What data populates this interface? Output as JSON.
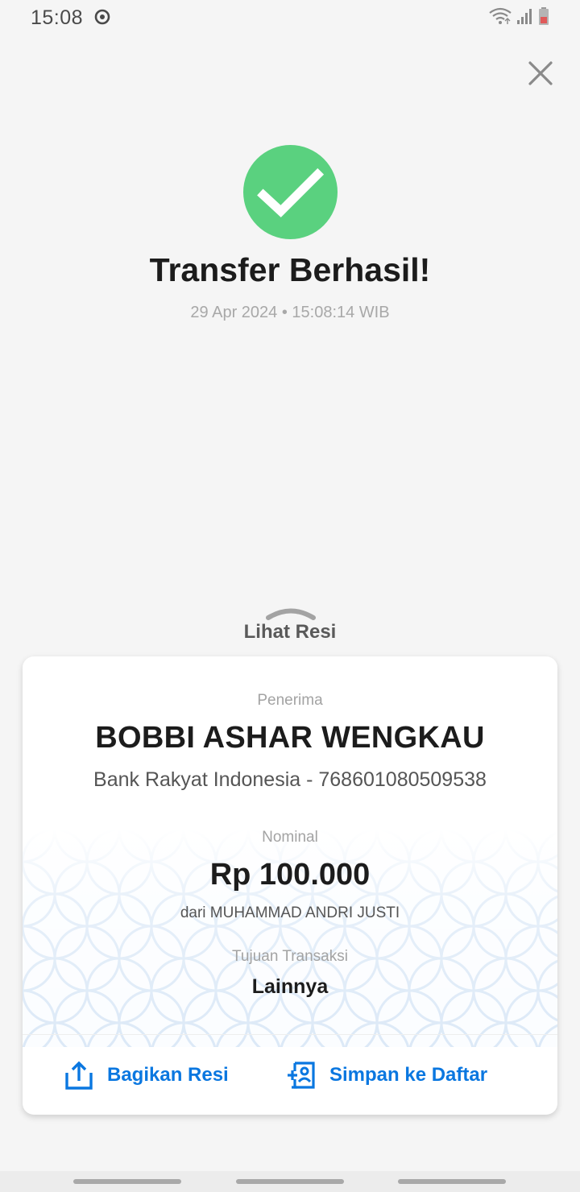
{
  "status_bar": {
    "time": "15:08",
    "icons": [
      "sync-icon",
      "wifi-icon",
      "signal-icon",
      "battery-icon"
    ]
  },
  "header": {
    "close_icon": "close-icon"
  },
  "result": {
    "status_icon": "check-circle-icon",
    "title": "Transfer Berhasil!",
    "datetime": "29 Apr 2024 • 15:08:14 WIB"
  },
  "receipt_toggle": {
    "handle_icon": "chevron-up-icon",
    "label": "Lihat Resi"
  },
  "receipt": {
    "recipient_label": "Penerima",
    "recipient_name": "BOBBI ASHAR WENGKAU",
    "recipient_bank": "Bank Rakyat Indonesia - 768601080509538",
    "amount_label": "Nominal",
    "amount": "Rp 100.000",
    "sender": "dari MUHAMMAD ANDRI JUSTI",
    "purpose_label": "Tujuan Transaksi",
    "purpose": "Lainnya"
  },
  "actions": {
    "share_label": "Bagikan Resi",
    "share_icon": "share-icon",
    "save_label": "Simpan ke Daftar",
    "save_icon": "add-contact-icon"
  },
  "colors": {
    "success": "#5ad17f",
    "accent": "#0a77e0",
    "background": "#f5f5f5",
    "card": "#ffffff"
  }
}
